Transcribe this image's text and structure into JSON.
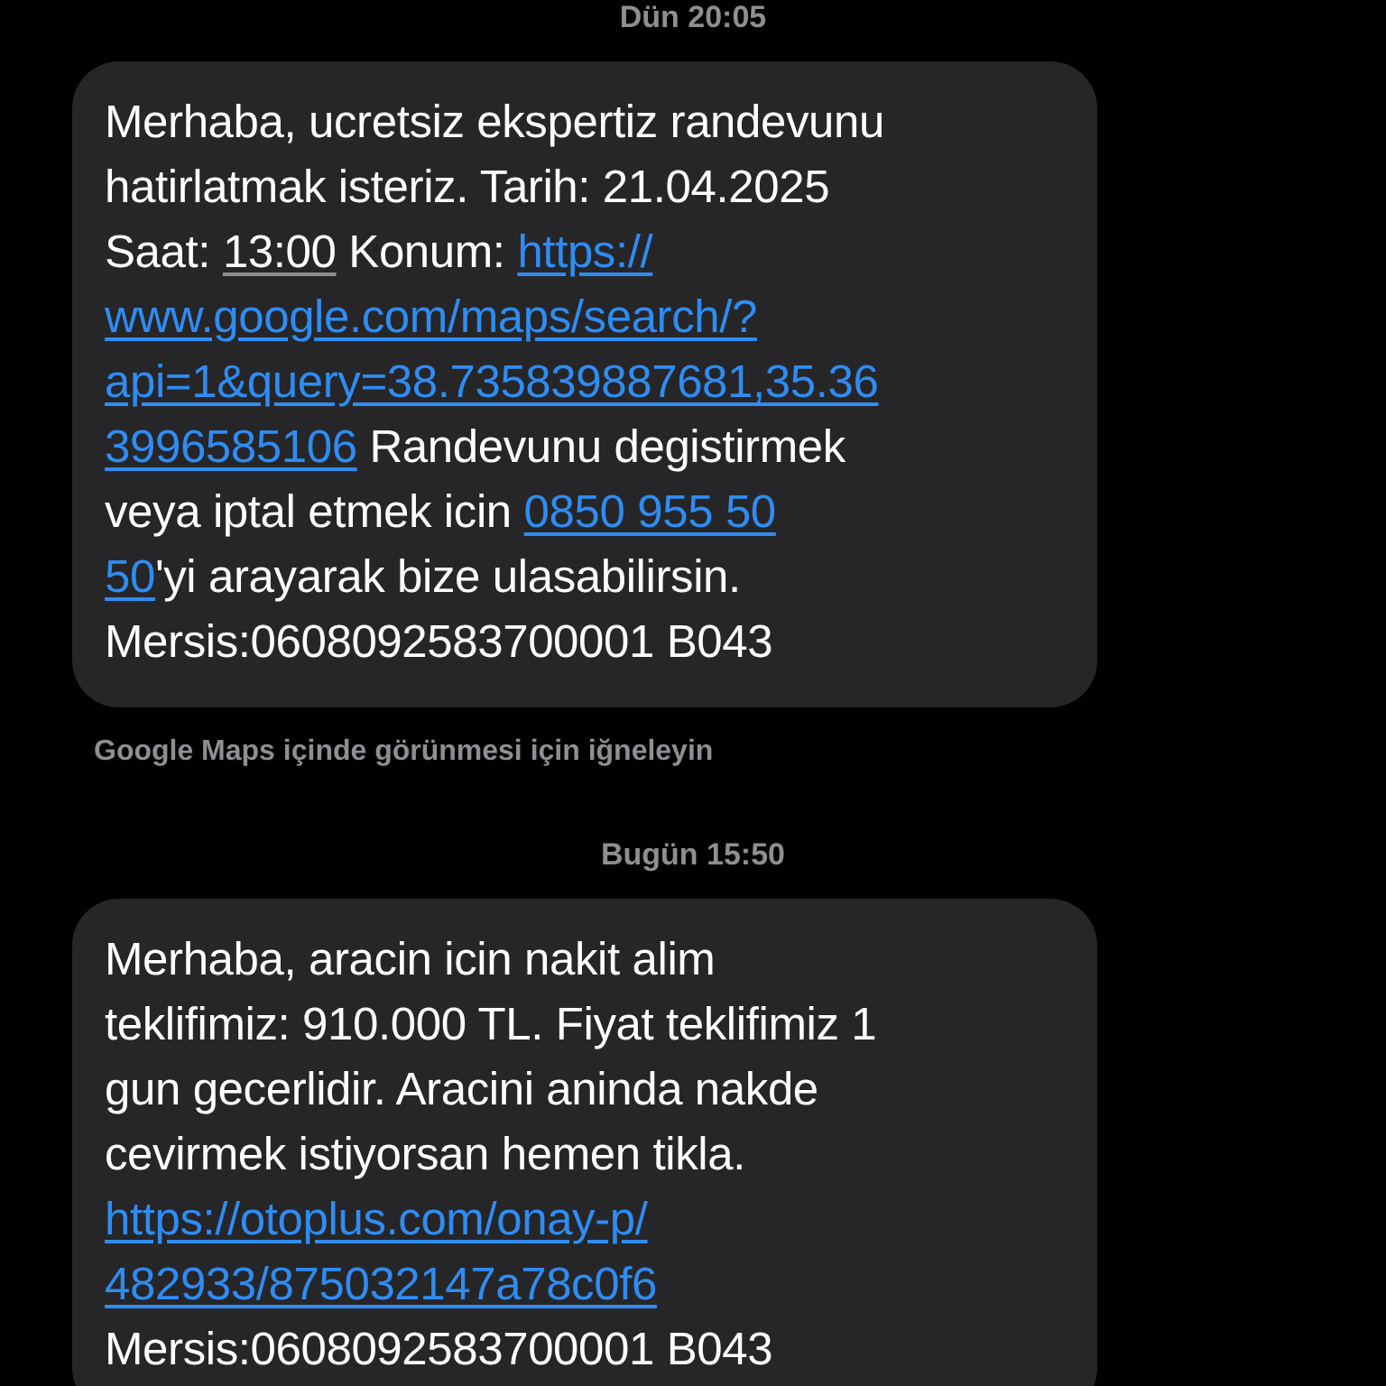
{
  "thread": [
    {
      "timestamp": "Dün 20:05",
      "message": {
        "lines": [
          [
            {
              "kind": "text",
              "text": "Merhaba, ucretsiz ekspertiz randevunu"
            }
          ],
          [
            {
              "kind": "text",
              "text": "hatirlatmak isteriz. Tarih: 21.04.2025"
            }
          ],
          [
            {
              "kind": "text",
              "text": "Saat: "
            },
            {
              "kind": "time",
              "text": "13:00"
            },
            {
              "kind": "text",
              "text": " Konum: "
            },
            {
              "kind": "link",
              "text": "https://"
            }
          ],
          [
            {
              "kind": "link",
              "text": "www.google.com/maps/search/?"
            }
          ],
          [
            {
              "kind": "link",
              "text": "api=1&query=38.735839887681,35.36"
            }
          ],
          [
            {
              "kind": "link",
              "text": "3996585106"
            },
            {
              "kind": "text",
              "text": " Randevunu degistirmek"
            }
          ],
          [
            {
              "kind": "text",
              "text": "veya iptal etmek icin "
            },
            {
              "kind": "link",
              "text": "0850 955 50"
            }
          ],
          [
            {
              "kind": "link",
              "text": "50"
            },
            {
              "kind": "text",
              "text": "'yi arayarak bize ulasabilirsin."
            }
          ],
          [
            {
              "kind": "text",
              "text": "Mersis:0608092583700001 B043"
            }
          ]
        ]
      },
      "note": "Google Maps içinde görünmesi için iğneleyin"
    },
    {
      "timestamp": "Bugün 15:50",
      "message": {
        "lines": [
          [
            {
              "kind": "text",
              "text": "Merhaba, aracin icin nakit alim"
            }
          ],
          [
            {
              "kind": "text",
              "text": "teklifimiz: 910.000 TL. Fiyat teklifimiz 1"
            }
          ],
          [
            {
              "kind": "text",
              "text": "gun gecerlidir. Aracini aninda nakde"
            }
          ],
          [
            {
              "kind": "text",
              "text": "cevirmek istiyorsan hemen tikla."
            }
          ],
          [
            {
              "kind": "link",
              "text": "https://otoplus.com/onay-p/"
            }
          ],
          [
            {
              "kind": "link",
              "text": "482933/875032147a78c0f6"
            }
          ],
          [
            {
              "kind": "text",
              "text": "Mersis:0608092583700001 B043"
            }
          ]
        ]
      }
    }
  ]
}
